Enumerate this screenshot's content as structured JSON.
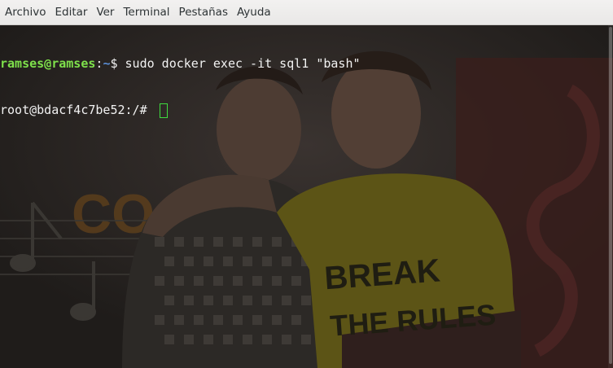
{
  "menubar": {
    "items": [
      {
        "label": "Archivo"
      },
      {
        "label": "Editar"
      },
      {
        "label": "Ver"
      },
      {
        "label": "Terminal"
      },
      {
        "label": "Pestañas"
      },
      {
        "label": "Ayuda"
      }
    ]
  },
  "terminal": {
    "line1": {
      "user_host": "ramses@ramses",
      "separator": ":",
      "path": "~",
      "prompt_symbol": "$ ",
      "command": "sudo docker exec -it sql1 \"bash\""
    },
    "line2": {
      "prompt": "root@bdacf4c7be52:/# "
    },
    "colors": {
      "user_host": "#7ee04b",
      "path": "#5b8fd6",
      "text": "#f2f2f2",
      "cursor": "#3fdc3f",
      "background": "#272420"
    }
  }
}
